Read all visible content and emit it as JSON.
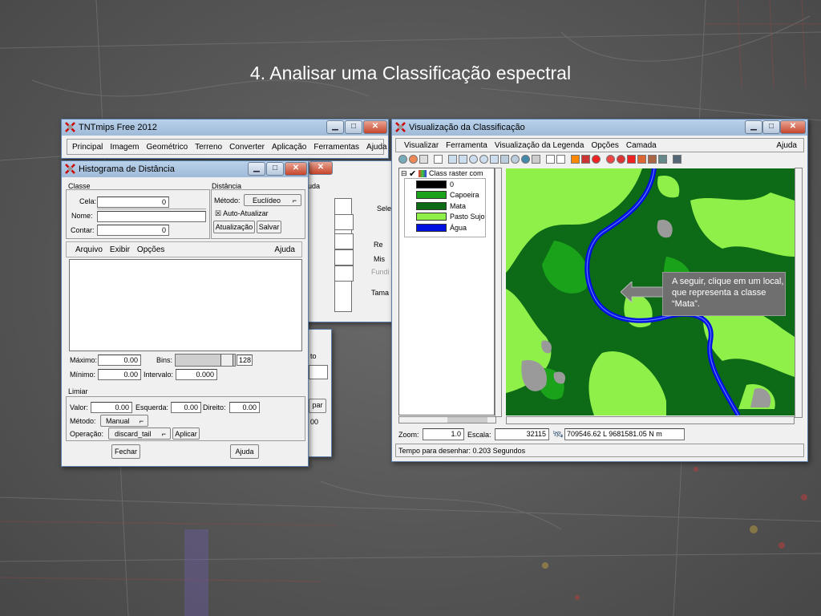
{
  "slide": {
    "title": "4. Analisar uma Classificação espectral"
  },
  "tnt_window": {
    "title": "TNTmips Free 2012",
    "menu": [
      "Principal",
      "Imagem",
      "Geométrico",
      "Terreno",
      "Converter",
      "Aplicação",
      "Ferramentas",
      "Ajuda"
    ],
    "hidden_fragments": {
      "ajuda": "uda",
      "sele": "Sele",
      "re": "Re",
      "mis": "Mis",
      "fund": "Fundi",
      "tama": "Tama",
      "to": "to",
      "par": "par",
      "oo": "00"
    }
  },
  "histogram": {
    "title": "Histograma de Distância",
    "classe_label": "Classe",
    "distancia_label": "Distância",
    "cela_label": "Cela:",
    "cela_value": "0",
    "nome_label": "Nome:",
    "contar_label": "Contar:",
    "contar_value": "0",
    "metodo_label": "Método:",
    "metodo_value": "Euclídeo",
    "auto_atualizar": "Auto-Atualizar",
    "atualizacao_button": "Atualização",
    "salvar_button": "Salvar",
    "menu": [
      "Arquivo",
      "Exibir",
      "Opções"
    ],
    "ajuda_menu": "Ajuda",
    "maximo_label": "Máximo:",
    "maximo_value": "0.00",
    "minimo_label": "Mínimo:",
    "minimo_value": "0.00",
    "bins_label": "Bins:",
    "bins_value": "128",
    "intervalo_label": "Intervalo:",
    "intervalo_value": "0.000",
    "limiar_label": "Limiar",
    "valor_label": "Valor:",
    "valor_value": "0.00",
    "esquerda_label": "Esquerda:",
    "esquerda_value": "0.00",
    "direita_label": "Direito:",
    "direita_value": "0.00",
    "metodo2_label": "Método:",
    "metodo2_value": "Manual",
    "operacao_label": "Operação:",
    "operacao_value": "discard_tail",
    "aplicar_button": "Aplicar",
    "fechar_button": "Fechar",
    "ajuda_button": "Ajuda"
  },
  "viz": {
    "title": "Visualização da Classificação",
    "menu": [
      "Visualizar",
      "Ferramenta",
      "Visualização da Legenda",
      "Opções",
      "Camada"
    ],
    "ajuda_menu": "Ajuda",
    "layer_name": "Class raster com",
    "legend": [
      {
        "label": "0",
        "color": "#000000"
      },
      {
        "label": "Capoeira",
        "color": "#1aa31a"
      },
      {
        "label": "Mata",
        "color": "#0b6a14"
      },
      {
        "label": "Pasto Sujo",
        "color": "#8ff04a"
      },
      {
        "label": "Água",
        "color": "#0010e0"
      }
    ],
    "zoom_label": "Zoom:",
    "zoom_value": "1.0",
    "escala_label": "Escala:",
    "escala_value": "32115",
    "coords": "709546.62 L  9681581.05 N m",
    "status": "Tempo para desenhar: 0.203 Segundos"
  },
  "callout": {
    "text": "A seguir, clique em um local, que representa a classe “Mata”."
  }
}
